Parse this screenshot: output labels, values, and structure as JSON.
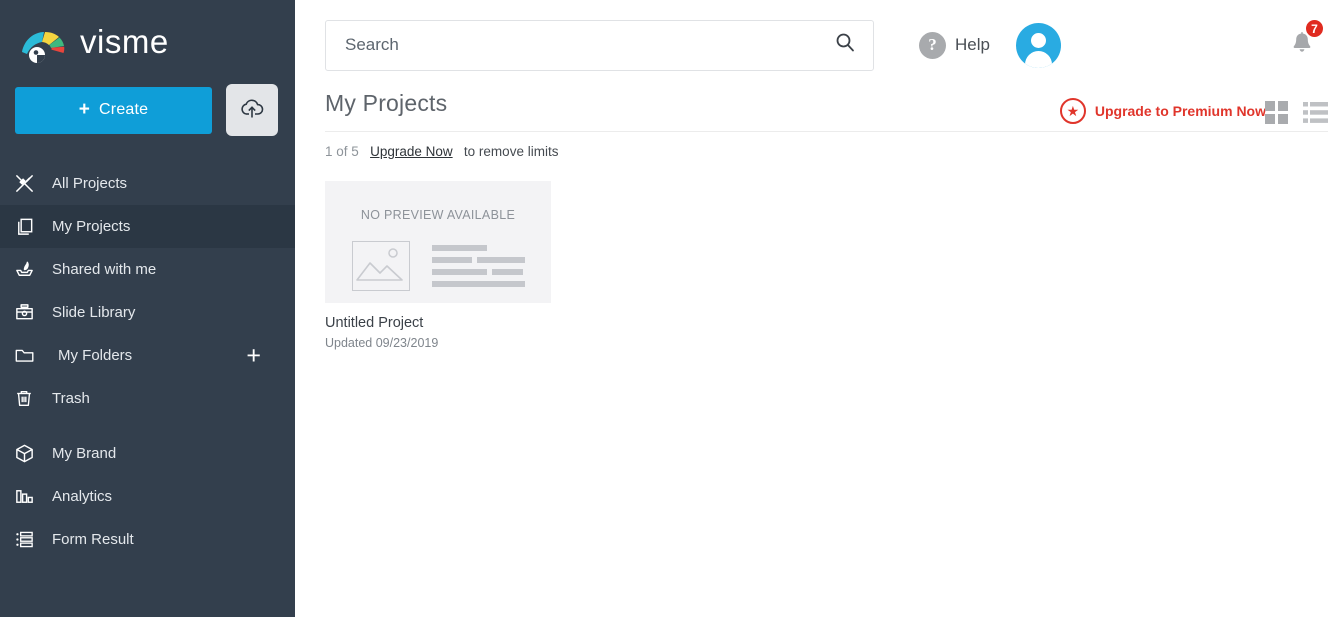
{
  "brand": {
    "name": "visme",
    "logo_icon": "visme-chameleon-logo"
  },
  "sidebar": {
    "create_button": {
      "label": "Create",
      "plus": "+",
      "color": "#0f9ed8"
    },
    "upload_button": {
      "icon": "cloud-upload-icon"
    },
    "items": [
      {
        "label": "All Projects",
        "icon": "all-projects-icon",
        "active": false
      },
      {
        "label": "My Projects",
        "icon": "my-projects-icon",
        "active": true
      },
      {
        "label": "Shared with me",
        "icon": "shared-with-me-icon",
        "active": false
      },
      {
        "label": "Slide Library",
        "icon": "slide-library-icon",
        "active": false
      },
      {
        "label": "My Folders",
        "icon": "folder-icon",
        "active": false,
        "trailing": "+"
      },
      {
        "label": "Trash",
        "icon": "trash-icon",
        "active": false
      },
      {
        "label": "My Brand",
        "icon": "cube-icon",
        "active": false
      },
      {
        "label": "Analytics",
        "icon": "bar-chart-icon",
        "active": false
      },
      {
        "label": "Form Result",
        "icon": "form-result-icon",
        "active": false
      }
    ],
    "background": "#333f4d",
    "active_background": "#2b3744"
  },
  "topbar": {
    "search": {
      "placeholder": "Search",
      "value": "",
      "icon": "search-icon"
    },
    "help": {
      "label": "Help",
      "icon": "question-mark-icon"
    },
    "avatar": {
      "icon": "user-avatar-icon"
    },
    "redaction": {
      "color": "#f57c2a",
      "note": "orange-marker-redaction"
    },
    "notifications": {
      "icon": "bell-icon",
      "count": "7",
      "badge_color": "#e02b20"
    }
  },
  "page": {
    "title": "My Projects",
    "upgrade_premium": {
      "label": "Upgrade to Premium Now",
      "icon": "star-icon",
      "color": "#e0352b"
    },
    "view_toggles": [
      {
        "icon": "grid-view-icon",
        "active": true
      },
      {
        "icon": "list-view-icon",
        "active": false
      }
    ],
    "limits": {
      "count": "1 of 5",
      "link": "Upgrade Now",
      "suffix": "to remove limits"
    }
  },
  "projects": [
    {
      "preview_text": "NO PREVIEW AVAILABLE",
      "title": "Untitled Project",
      "updated": "Updated 09/23/2019"
    }
  ]
}
